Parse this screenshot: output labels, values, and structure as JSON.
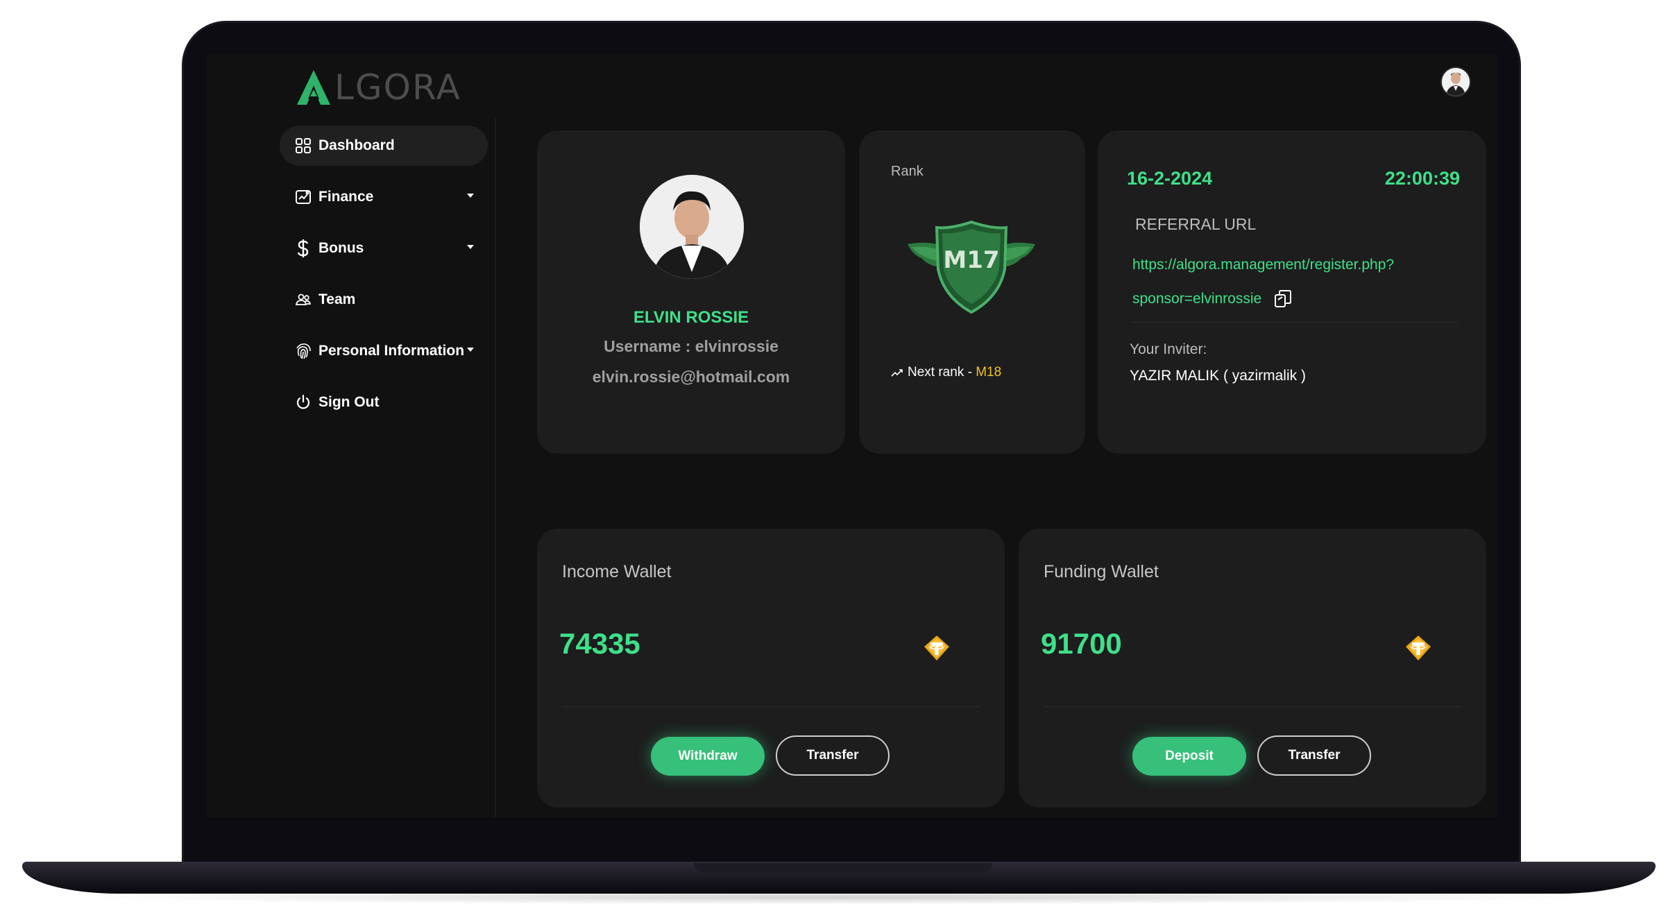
{
  "brand": {
    "logo_text": "LGORA",
    "accent_color": "#3ee08a",
    "gold_color": "#f3c21a"
  },
  "header": {
    "avatar_icon": "user-avatar"
  },
  "sidebar": {
    "items": [
      {
        "label": "Dashboard",
        "icon": "grid-icon",
        "active": true,
        "has_caret": false
      },
      {
        "label": "Finance",
        "icon": "chart-icon",
        "active": false,
        "has_caret": true
      },
      {
        "label": "Bonus",
        "icon": "dollar-icon",
        "active": false,
        "has_caret": true
      },
      {
        "label": "Team",
        "icon": "team-icon",
        "active": false,
        "has_caret": false
      },
      {
        "label": "Personal Information",
        "icon": "fingerprint-icon",
        "active": false,
        "has_caret": true
      },
      {
        "label": "Sign Out",
        "icon": "power-icon",
        "active": false,
        "has_caret": false
      }
    ]
  },
  "profile": {
    "name": "ELVIN ROSSIE",
    "username": "Username : elvinrossie",
    "email": "elvin.rossie@hotmail.com"
  },
  "rank": {
    "label": "Rank",
    "current": "M17",
    "next_prefix": "Next rank - ",
    "next": "M18"
  },
  "referral": {
    "date": "16-2-2024",
    "time": "22:00:39",
    "label": "REFERRAL URL",
    "url_line1": "https://algora.management/register.php?",
    "url_line2": "sponsor=elvinrossie",
    "inviter_label": "Your Inviter:",
    "inviter_value": "YAZIR MALIK ( yazirmalik )"
  },
  "wallets": {
    "income": {
      "title": "Income Wallet",
      "amount": "74335",
      "primary_label": "Withdraw",
      "secondary_label": "Transfer",
      "token_icon": "tether-icon"
    },
    "funding": {
      "title": "Funding Wallet",
      "amount": "91700",
      "primary_label": "Deposit",
      "secondary_label": "Transfer",
      "token_icon": "tether-icon"
    }
  }
}
